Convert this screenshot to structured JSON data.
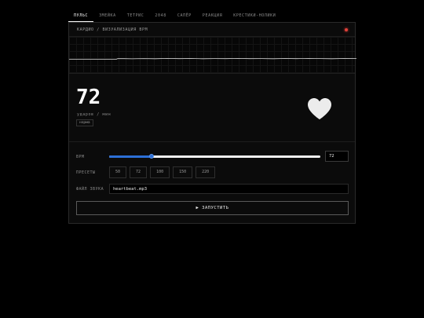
{
  "nav": {
    "tabs": [
      {
        "label": "пульс",
        "active": true
      },
      {
        "label": "змейка",
        "active": false
      },
      {
        "label": "тетрис",
        "active": false
      },
      {
        "label": "2048",
        "active": false
      },
      {
        "label": "сапёр",
        "active": false
      },
      {
        "label": "реакция",
        "active": false
      },
      {
        "label": "крестики-нолики",
        "active": false
      }
    ]
  },
  "card": {
    "title": "кардио / визуализация bpm"
  },
  "display": {
    "bpm": "72",
    "unit": "ударов / мин",
    "status": "норма"
  },
  "controls": {
    "bpm_label": "bpm",
    "bpm_value": "72",
    "bpm_min": 30,
    "bpm_max": 240,
    "presets_label": "пресеты",
    "presets": [
      "50",
      "72",
      "100",
      "150",
      "220"
    ],
    "file_label": "файл звука",
    "file_value": "heartbeat.mp3",
    "start_label": "▶ запустить"
  },
  "colors": {
    "accent": "#2c6fd6",
    "rec": "#e0413a",
    "background": "#000000"
  }
}
